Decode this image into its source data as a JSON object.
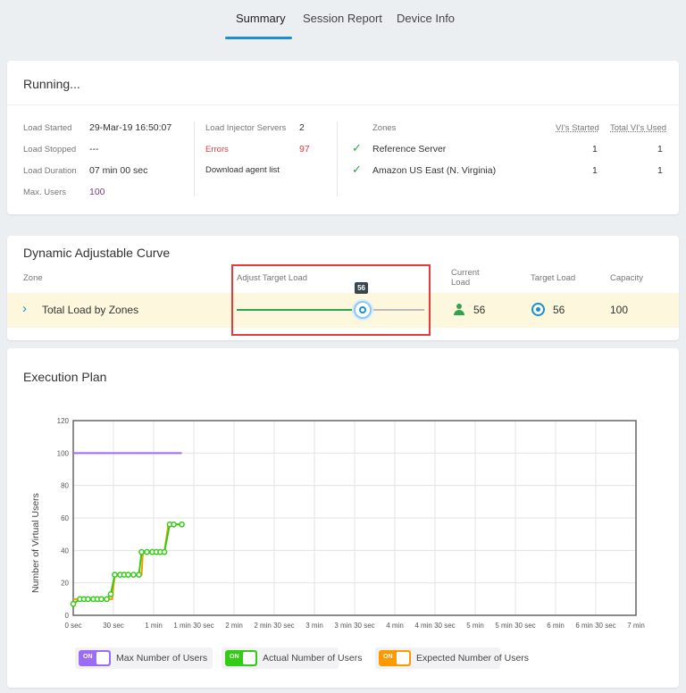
{
  "tabs": [
    {
      "label": "Summary",
      "active": true
    },
    {
      "label": "Session Report"
    },
    {
      "label": "Device Info"
    }
  ],
  "status": {
    "title": "Running...",
    "load_started_label": "Load Started",
    "load_started": "29-Mar-19 16:50:07",
    "load_stopped_label": "Load Stopped",
    "load_stopped": "---",
    "load_duration_label": "Load Duration",
    "load_duration": "07 min 00 sec",
    "max_users_label": "Max. Users",
    "max_users": "100",
    "injectors_label": "Load Injector Servers",
    "injectors": "2",
    "errors_label": "Errors",
    "errors": "97",
    "download_label": "Download agent list",
    "zones_header": "Zones",
    "vis_started_header": "VI's Started",
    "total_vis_header": "Total VI's Used",
    "zones": [
      {
        "name": "Reference Server",
        "started": "1",
        "used": "1"
      },
      {
        "name": "Amazon US East (N. Virginia)",
        "started": "1",
        "used": "1"
      }
    ]
  },
  "curve": {
    "title": "Dynamic Adjustable Curve",
    "col_zone": "Zone",
    "col_adjust": "Adjust Target Load",
    "col_current": "Current Load",
    "col_target": "Target Load",
    "col_capacity": "Capacity",
    "row": {
      "label": "Total Load by Zones",
      "slider_value": 56,
      "slider_tooltip": "56",
      "slider_max": 100,
      "current": "56",
      "target": "56",
      "capacity": "100"
    }
  },
  "plan": {
    "title": "Execution Plan"
  },
  "colors": {
    "accent": "#1a8fd6",
    "max": "#9b6cf5",
    "actual": "#33cc14",
    "expected": "#ff9900",
    "error": "#e8393d"
  },
  "chart_data": {
    "type": "line",
    "ylabel": "Number of Virtual Users",
    "ylim": [
      0,
      120
    ],
    "yticks": [
      "0",
      "20",
      "40",
      "60",
      "80",
      "100",
      "120"
    ],
    "xlim_sec": [
      0,
      420
    ],
    "xticks": [
      "0 sec",
      "30 sec",
      "1 min",
      "1 min 30 sec",
      "2 min",
      "2 min 30 sec",
      "3 min",
      "3 min 30 sec",
      "4 min",
      "4 min 30 sec",
      "5 min",
      "5 min 30 sec",
      "6 min",
      "6 min 30 sec",
      "7 min"
    ],
    "grid": true,
    "legend_position": "bottom",
    "series": [
      {
        "name": "Max Number of Users",
        "color": "#9b6cf5",
        "x": [
          0,
          81
        ],
        "y": [
          100,
          100
        ]
      },
      {
        "name": "Actual Number of Users",
        "color": "#33cc14",
        "markers": true,
        "x": [
          0,
          5,
          8,
          11,
          15,
          18,
          21,
          25,
          28,
          31,
          35,
          38,
          41,
          45,
          49,
          51,
          55,
          59,
          62,
          65,
          68,
          72,
          75,
          81
        ],
        "y": [
          7,
          10,
          10,
          10,
          10,
          10,
          10,
          10,
          13,
          25,
          25,
          25,
          25,
          25,
          25,
          39,
          39,
          39,
          39,
          39,
          39,
          56,
          56,
          56
        ]
      },
      {
        "name": "Expected Number of Users",
        "color": "#ff9900",
        "x": [
          0,
          29,
          31,
          51,
          52,
          68,
          71,
          81
        ],
        "y": [
          10,
          10,
          25,
          25,
          39,
          39,
          56,
          56
        ]
      }
    ]
  },
  "legend": {
    "toggle_label": "ON"
  }
}
